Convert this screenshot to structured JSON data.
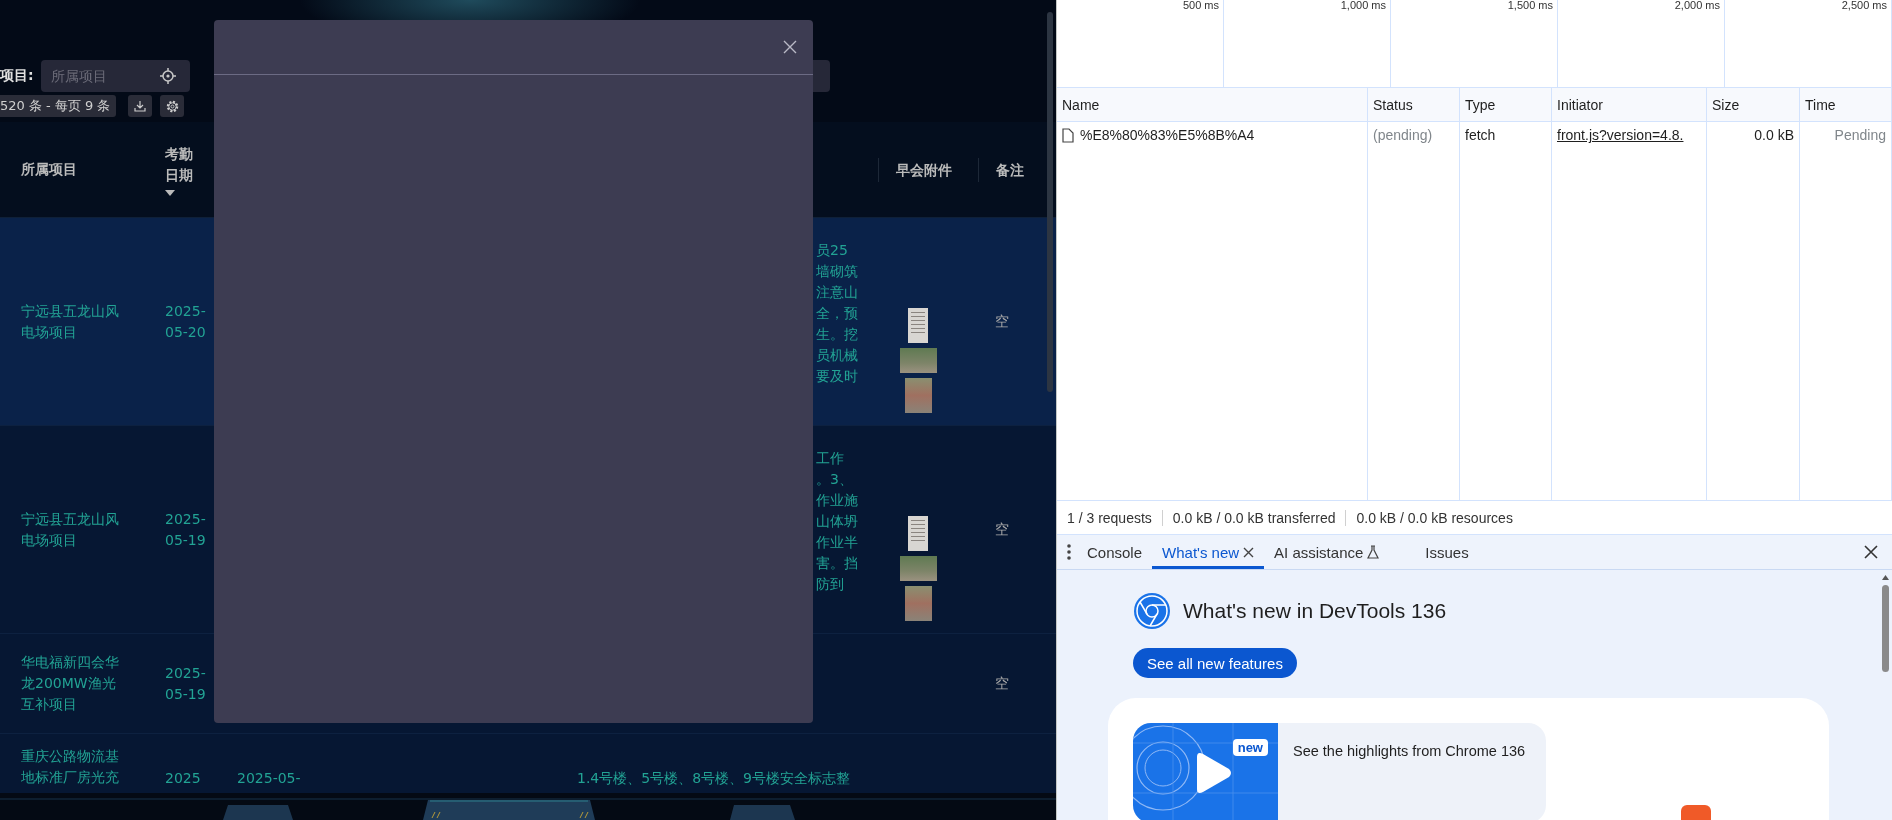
{
  "app": {
    "filter": {
      "label": "项目:",
      "project_field": {
        "placeholder": "所属项目"
      }
    },
    "pagination": "520 条 - 每页 9 条",
    "table": {
      "columns": [
        {
          "label": "所属项目",
          "sortable": false
        },
        {
          "label": "考勤日期",
          "sortable": true
        },
        {
          "label": "早会附件",
          "sortable": false
        },
        {
          "label": "备注",
          "sortable": false
        }
      ],
      "rows": [
        {
          "selected": true,
          "project": "宁远县五龙山风电场项目",
          "date": "2025-05-20",
          "description_visible_part": [
            "员25",
            "墙砌筑",
            "注意山",
            "全，预",
            "生。挖",
            "员机械",
            "要及时"
          ],
          "attachments": [
            {
              "kind": "document"
            },
            {
              "kind": "landscape"
            },
            {
              "kind": "portrait"
            }
          ],
          "remark": "空"
        },
        {
          "selected": false,
          "project": "宁远县五龙山风电场项目",
          "date": "2025-05-19",
          "description_visible_part": [
            "工作",
            "。3、",
            "作业施",
            "山体坍",
            "作业半",
            "害。挡",
            "防到"
          ],
          "attachments": [
            {
              "kind": "document"
            },
            {
              "kind": "landscape"
            },
            {
              "kind": "portrait"
            }
          ],
          "remark": "空"
        },
        {
          "selected": false,
          "project": "华电福新四会华龙200MW渔光互补项目",
          "date": "2025-05-19",
          "remark": "空"
        },
        {
          "selected": false,
          "project": "重庆公路物流基地标准厂房光充",
          "date": "2025",
          "column_3": "2025-05-",
          "description": "1.4号楼、5号楼、8号楼、9号楼安全标志整"
        }
      ]
    }
  },
  "devtools": {
    "timeline_ticks": [
      "500 ms",
      "1,000 ms",
      "1,500 ms",
      "2,000 ms",
      "2,500 ms"
    ],
    "network": {
      "columns": [
        "Name",
        "Status",
        "Type",
        "Initiator",
        "Size",
        "Time"
      ],
      "rows": [
        {
          "name": "%E8%80%83%E5%8B%A4",
          "status": "(pending)",
          "type": "fetch",
          "initiator": "front.js?version=4.8.",
          "size": "0.0 kB",
          "time": "Pending"
        }
      ]
    },
    "summary": [
      "1 / 3 requests",
      "0.0 kB / 0.0 kB transferred",
      "0.0 kB / 0.0 kB resources"
    ],
    "drawer": {
      "tabs": [
        {
          "label": "Console",
          "selected": false,
          "closable": false,
          "experimental": false
        },
        {
          "label": "What's new",
          "selected": true,
          "closable": true,
          "experimental": false
        },
        {
          "label": "AI assistance",
          "selected": false,
          "closable": false,
          "experimental": true
        },
        {
          "label": "Issues",
          "selected": false,
          "closable": false,
          "experimental": false
        }
      ]
    },
    "whats_new": {
      "title": "What's new in DevTools 136",
      "button": "See all new features",
      "video": {
        "badge": "new",
        "caption": "See the highlights from Chrome 136"
      }
    }
  }
}
